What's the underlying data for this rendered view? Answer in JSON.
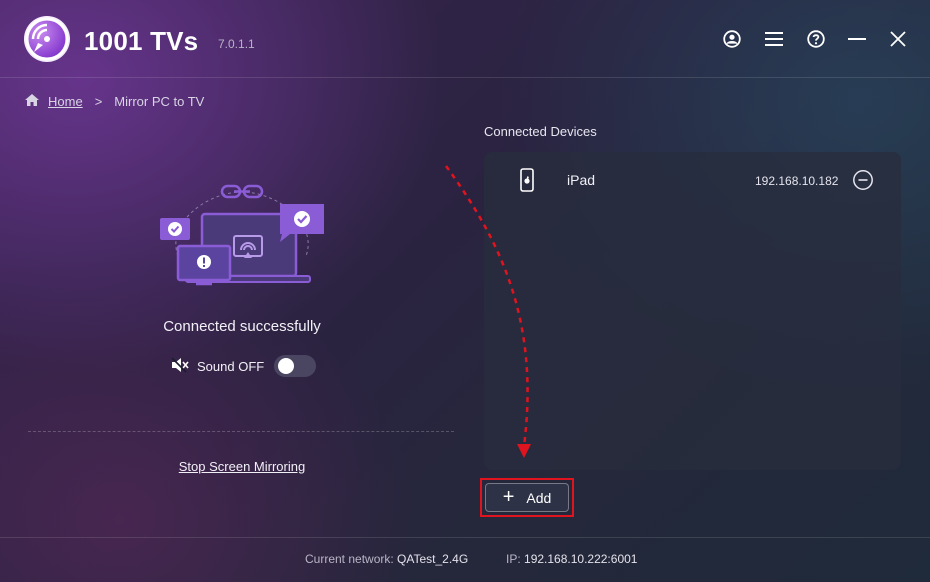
{
  "app": {
    "name": "1001 TVs",
    "version": "7.0.1.1"
  },
  "breadcrumb": {
    "home": "Home",
    "separator": ">",
    "current": "Mirror PC to TV"
  },
  "status": {
    "text": "Connected successfully"
  },
  "sound": {
    "label": "Sound OFF",
    "enabled": false
  },
  "stop_link": "Stop Screen Mirroring",
  "devices": {
    "title": "Connected Devices",
    "items": [
      {
        "name": "iPad",
        "ip": "192.168.10.182"
      }
    ]
  },
  "add_button": {
    "label": "Add"
  },
  "footer": {
    "network_label": "Current network:",
    "network_value": "QATest_2.4G",
    "ip_label": "IP:",
    "ip_value": "192.168.10.222:6001"
  },
  "icons": {
    "title_bar": [
      "account-icon",
      "menu-icon",
      "help-icon",
      "minimize-icon",
      "close-icon"
    ],
    "device": "apple-phone-icon",
    "remove": "minus-circle-icon",
    "sound": "speaker-muted-icon",
    "breadcrumb": "home-icon"
  },
  "colors": {
    "accent": "#8a3fd0",
    "highlight": "#e0141e",
    "illustration": "#8a5cd6"
  }
}
